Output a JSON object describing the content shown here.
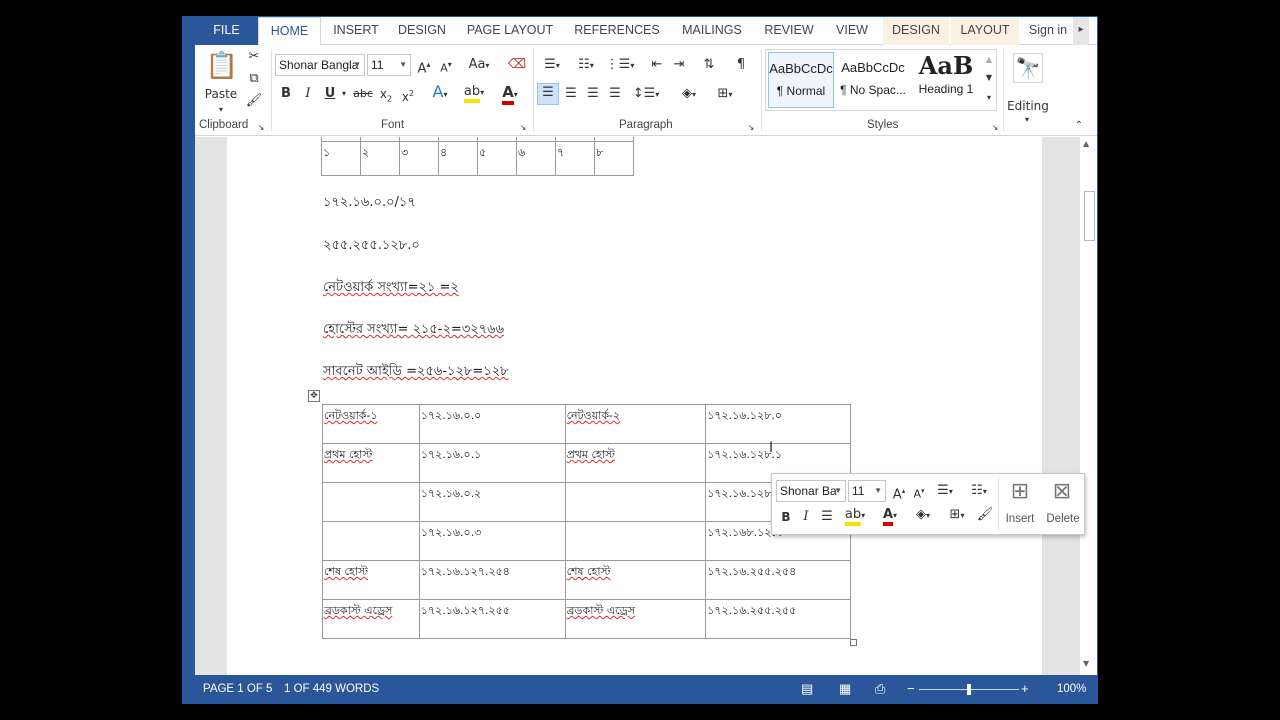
{
  "tabs": [
    {
      "label": "FILE"
    },
    {
      "label": "HOME"
    },
    {
      "label": "INSERT"
    },
    {
      "label": "DESIGN"
    },
    {
      "label": "PAGE LAYOUT"
    },
    {
      "label": "REFERENCES"
    },
    {
      "label": "MAILINGS"
    },
    {
      "label": "REVIEW"
    },
    {
      "label": "VIEW"
    },
    {
      "label": "DESIGN"
    },
    {
      "label": "LAYOUT"
    }
  ],
  "sign_in": "Sign in",
  "clipboard": {
    "paste": "Paste",
    "label": "Clipboard"
  },
  "font": {
    "name": "Shonar Bangla",
    "size": "11",
    "label": "Font"
  },
  "paragraph": {
    "label": "Paragraph"
  },
  "styles": {
    "label": "Styles",
    "items": [
      {
        "preview": "AaBbCcDc",
        "name": "¶ Normal"
      },
      {
        "preview": "AaBbCcDc",
        "name": "¶ No Spac..."
      },
      {
        "preview": "AaB",
        "name": "Heading 1"
      }
    ]
  },
  "editing": {
    "label": "Editing"
  },
  "document": {
    "top_table_row": [
      "১",
      "২",
      "৩",
      "৪",
      "৫",
      "৬",
      "৭",
      "৮"
    ],
    "lines": [
      "১৭২.১৬.০.০/১৭",
      "২৫৫.২৫৫.১২৮.০",
      "নেটওয়ার্ক সংখ্যা=২১ =২",
      "হোস্টের সংখ্যা= ২১৫-২=৩২৭৬৬",
      "সাবনেট আইডি =২৫৬-১২৮=১২৮"
    ],
    "table": [
      [
        "নেটওয়ার্ক-১",
        "১৭২.১৬.০.০",
        "নেটওয়ার্ক-২",
        "১৭২.১৬.১২৮.০"
      ],
      [
        "প্রথম হোস্ট",
        "১৭২.১৬.০.১",
        "প্রথম হোস্ট",
        "১৭২.১৬.১২৮.১"
      ],
      [
        "",
        "১৭২.১৬.০.২",
        "",
        "১৭২.১৬.১২৮.২"
      ],
      [
        "",
        "১৭২.১৬.০.৩",
        "",
        "১৭২.১৬৮.১২৮.৩"
      ],
      [
        "শেষ হোস্ট",
        "১৭২.১৬.১২৭.২৫৪",
        "শেষ হোস্ট",
        "১৭২.১৬.২৫৫.২৫৪"
      ],
      [
        "ব্রডকাস্ট এড্রেস",
        "১৭২.১৬.১২৭.২৫৫",
        "ব্রডকাস্ট এড্রেস",
        "১৭২.১৬.২৫৫.২৫৫"
      ]
    ]
  },
  "mini_toolbar": {
    "font": "Shonar Ba",
    "size": "11",
    "insert": "Insert",
    "delete": "Delete"
  },
  "status": {
    "page": "PAGE 1 OF 5",
    "words": "1 OF 449 WORDS",
    "zoom": "100%",
    "zoom_fraction": 0.5
  },
  "colors": {
    "accent": "#2b579a",
    "context_tab": "#fbf1e3"
  }
}
